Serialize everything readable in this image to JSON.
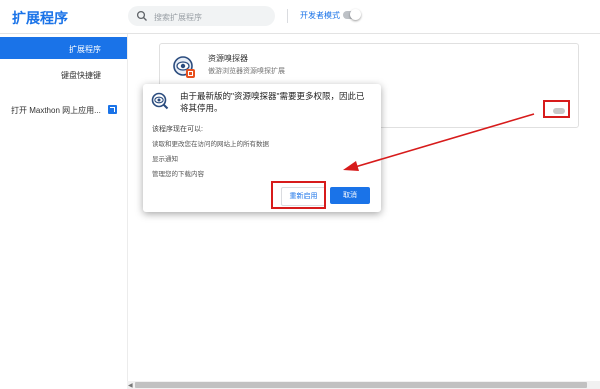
{
  "header": {
    "app_title": "扩展程序",
    "search_placeholder": "搜索扩展程序",
    "dev_mode_label": "开发者模式",
    "dev_mode_on": false
  },
  "sidebar": {
    "items": [
      {
        "label": "扩展程序",
        "active": true
      },
      {
        "label": "键盘快捷键",
        "active": false
      }
    ],
    "open_store": "打开 Maxthon 网上应用..."
  },
  "extension": {
    "name": "资源嗅探器",
    "description": "傲游浏览器资源嗅探扩展"
  },
  "dialog": {
    "title": "由于最新版的\"资源嗅探器\"需要更多权限，因此已将其停用。",
    "subtitle": "该程序现在可以:",
    "permissions": [
      "读取和更改您在访问的网站上的所有数据",
      "显示通知",
      "管理您的下载内容"
    ],
    "reenable_label": "重新启用",
    "cancel_label": "取消"
  },
  "colors": {
    "accent": "#1a73e8",
    "annotation": "#d71b1b"
  }
}
